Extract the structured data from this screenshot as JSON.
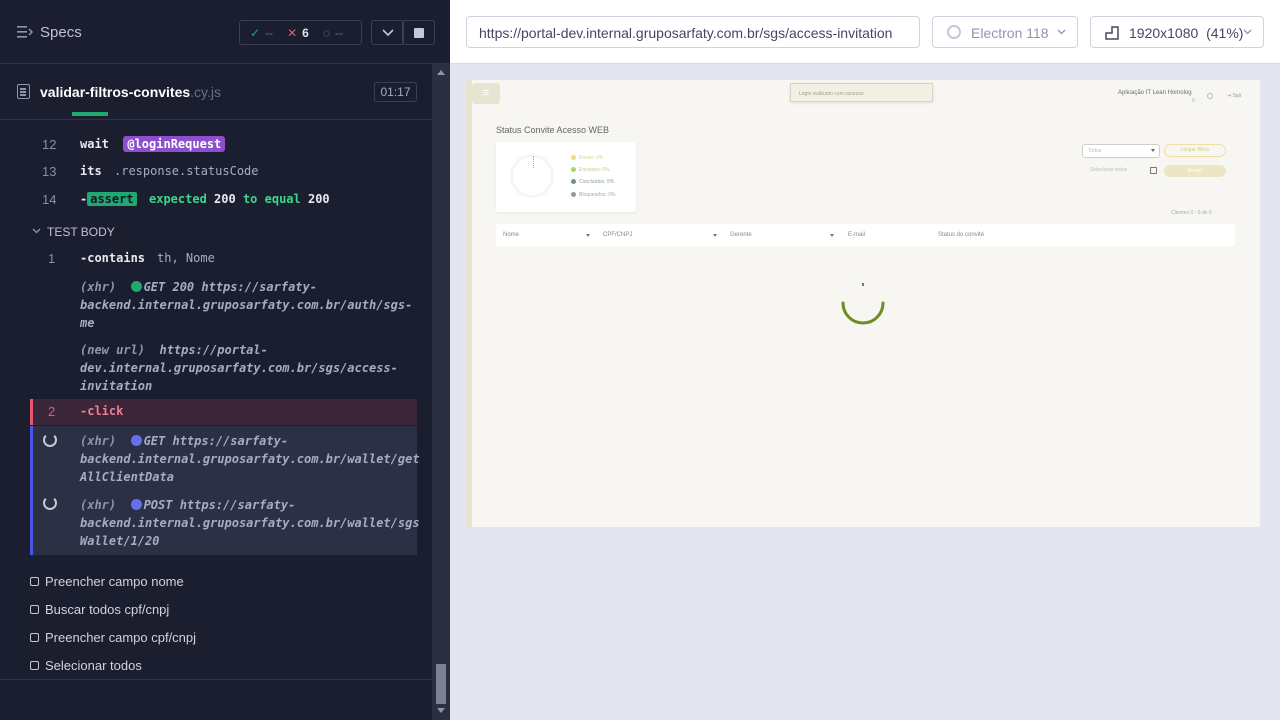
{
  "reporter": {
    "specs_label": "Specs",
    "stats": {
      "passed": "--",
      "failed": "6",
      "pending": "--"
    },
    "file": {
      "name": "validar-filtros-convites",
      "ext": ".cy.js"
    },
    "timer": "01:17",
    "commands": [
      {
        "num": "12",
        "name": "wait",
        "alias": "@loginRequest"
      },
      {
        "num": "13",
        "name": "its",
        "message": ".response.statusCode"
      },
      {
        "num": "14",
        "name": "-assert",
        "w1": "expected",
        "v1": "200",
        "w2": "to equal",
        "v2": "200"
      }
    ],
    "test_body_label": "TEST BODY",
    "body_commands": [
      {
        "num": "1",
        "name": "-contains",
        "message": "th, Nome"
      },
      {
        "num": "2",
        "name": "-click"
      }
    ],
    "logs": [
      {
        "type": "(xhr)",
        "text": "GET 200 https://sarfaty-",
        "line2": "backend.internal.gruposarfaty.com.br/auth/sgs-",
        "line3": "me"
      },
      {
        "type": "(new url)",
        "text": "https://portal-",
        "line2": "dev.internal.gruposarfaty.com.br/sgs/access-",
        "line3": "invitation"
      },
      {
        "type": "(xhr)",
        "text": "GET https://sarfaty-",
        "line2": "backend.internal.gruposarfaty.com.br/wallet/get",
        "line3": "AllClientData"
      },
      {
        "type": "(xhr)",
        "text": "POST https://sarfaty-",
        "line2": "backend.internal.gruposarfaty.com.br/wallet/sgs",
        "line3": "Wallet/1/20"
      }
    ],
    "tests": [
      "Preencher campo nome",
      "Buscar todos cpf/cnpj",
      "Preencher campo cpf/cnpj",
      "Selecionar todos"
    ]
  },
  "browser": {
    "url": "https://portal-dev.internal.gruposarfaty.com.br/sgs/access-invitation",
    "name": "Electron 118",
    "viewport": "1920x1080",
    "scale": "(41%)"
  },
  "app": {
    "menu_icon": "≡",
    "toast": "Login realizado com sucesso.",
    "user": "Aplicação IT Lean Homolog",
    "user_sub": "0",
    "logout": "Sair",
    "title": "Status Convite Acesso WEB",
    "legend": [
      {
        "label": "Enviar: 0%",
        "color": "#f0dc82"
      },
      {
        "label": "Enviados: 0%",
        "color": "#a6d66e"
      },
      {
        "label": "Concluídos: 0%",
        "color": "#6e9378"
      },
      {
        "label": "Bloqueados: 0%",
        "color": "#999999"
      }
    ],
    "select_value": "Todos",
    "clear_filters": "Limpar filtros",
    "select_all": "Selecionar todos",
    "send": "Enviar",
    "clients_count": "Clientes 0 - 0 de 0",
    "columns": [
      "Nome",
      "CPF/CNPJ",
      "Gerente",
      "E-mail",
      "Status do convite"
    ]
  },
  "colors": {
    "pass": "#1fa971",
    "fail": "#e45770",
    "alias": "#8c4fcf",
    "running": "#4956e3",
    "loader": "#6b8e23"
  }
}
